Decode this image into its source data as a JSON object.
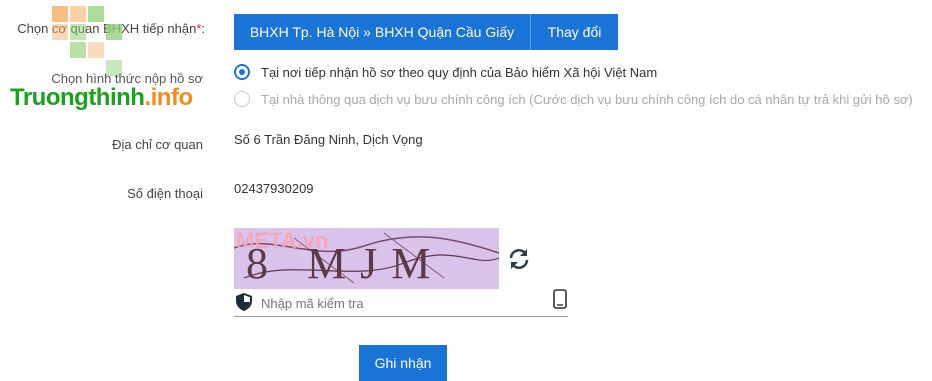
{
  "form": {
    "agency_label": "Chọn cơ quan BHXH tiếp nhận",
    "required_mark": "*",
    "agency_label_colon": ":",
    "agency_path": "BHXH Tp. Hà Nội » BHXH Quận Cầu Giấy",
    "change_label": "Thay đổi",
    "method_label": "Chọn hình thức nộp hồ sơ",
    "method_options": [
      {
        "label": "Tại nơi tiếp nhận hồ sơ theo quy định của Bảo hiểm Xã hội Việt Nam",
        "selected": true
      },
      {
        "label": "Tại nhà thông qua dịch vụ bưu chính công ích (Cước dịch vụ bưu chính công ích do cá nhân tự trả khi gửi hồ sơ)",
        "selected": false
      }
    ],
    "address_label": "Địa chỉ cơ quan",
    "address_value": "Số 6 Trần Đăng Ninh, Dịch Vọng",
    "phone_label": "Số điện thoại",
    "phone_value": "02437930209",
    "captcha_text": "8 MJM",
    "captcha_placeholder": "Nhập mã kiểm tra",
    "submit_label": "Ghi nhận"
  },
  "watermarks": {
    "site_name": "Truongthinh",
    "site_suffix": ".info",
    "captcha_overlay": "META.vn"
  },
  "colors": {
    "primary": "#1a73d6",
    "required": "#e02020",
    "captcha_bg": "#d9c3ea",
    "logo_green": "#19a31b",
    "logo_orange": "#f28c1c"
  },
  "icons": {
    "refresh": "refresh-icon",
    "shield": "shield-icon",
    "phone": "mobile-phone-icon"
  }
}
